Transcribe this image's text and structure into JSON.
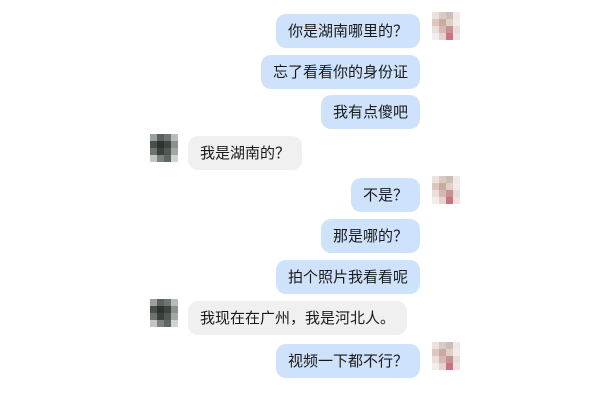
{
  "messages": [
    {
      "sender": "me",
      "text": "你是湖南哪里的？"
    },
    {
      "sender": "me",
      "text": "忘了看看你的身份证"
    },
    {
      "sender": "me",
      "text": "我有点傻吧"
    },
    {
      "sender": "them",
      "text": "我是湖南的？"
    },
    {
      "sender": "me",
      "text": "不是？"
    },
    {
      "sender": "me",
      "text": "那是哪的？"
    },
    {
      "sender": "me",
      "text": "拍个照片我看看呢"
    },
    {
      "sender": "them",
      "text": "我现在在广州，我是河北人。"
    },
    {
      "sender": "me",
      "text": "视频一下都不行？"
    }
  ],
  "colors": {
    "me_bubble": "#cfe2fb",
    "them_bubble": "#f0f0f0",
    "background": "#ffffff"
  },
  "icons": {
    "me_avatar": "pixelated-avatar-icon",
    "them_avatar": "pixelated-avatar-icon"
  }
}
